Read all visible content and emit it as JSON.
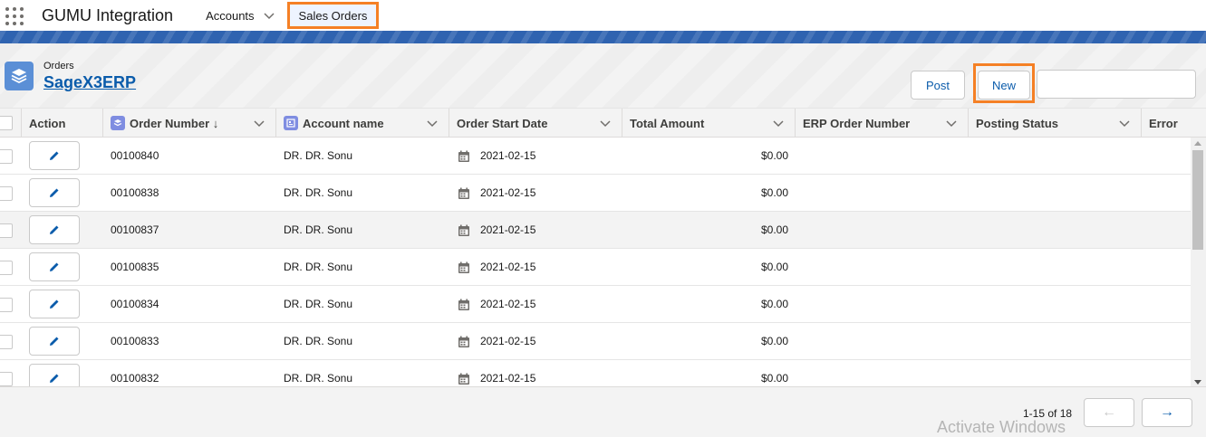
{
  "topbar": {
    "app_name": "GUMU Integration",
    "nav_items": [
      {
        "label": "Accounts",
        "has_dropdown": true
      },
      {
        "label": "Sales Orders",
        "active": true
      }
    ]
  },
  "header": {
    "object_label": "Orders",
    "list_title": "SageX3ERP",
    "post_label": "Post",
    "new_label": "New",
    "search_value": ""
  },
  "table": {
    "columns": [
      {
        "label": "Action"
      },
      {
        "label": "Order Number ↓",
        "icon": "order-icon"
      },
      {
        "label": "Account name",
        "icon": "account-icon"
      },
      {
        "label": "Order Start Date"
      },
      {
        "label": "Total Amount"
      },
      {
        "label": "ERP Order Number"
      },
      {
        "label": "Posting Status"
      },
      {
        "label": "Error"
      }
    ],
    "rows": [
      {
        "order_number": "00100840",
        "account": "DR. DR. Sonu",
        "date": "2021-02-15",
        "amount": "$0.00"
      },
      {
        "order_number": "00100838",
        "account": "DR. DR. Sonu",
        "date": "2021-02-15",
        "amount": "$0.00"
      },
      {
        "order_number": "00100837",
        "account": "DR. DR. Sonu",
        "date": "2021-02-15",
        "amount": "$0.00"
      },
      {
        "order_number": "00100835",
        "account": "DR. DR. Sonu",
        "date": "2021-02-15",
        "amount": "$0.00"
      },
      {
        "order_number": "00100834",
        "account": "DR. DR. Sonu",
        "date": "2021-02-15",
        "amount": "$0.00"
      },
      {
        "order_number": "00100833",
        "account": "DR. DR. Sonu",
        "date": "2021-02-15",
        "amount": "$0.00"
      },
      {
        "order_number": "00100832",
        "account": "DR. DR. Sonu",
        "date": "2021-02-15",
        "amount": "$0.00"
      }
    ]
  },
  "pagination": {
    "count_label": "1-15 of 18",
    "prev_arrow": "←",
    "next_arrow": "→"
  },
  "watermark": "Activate Windows",
  "colors": {
    "brand_blue": "#0b5cab",
    "highlight_orange": "#f58025",
    "banner_blue": "#2f63b0"
  }
}
